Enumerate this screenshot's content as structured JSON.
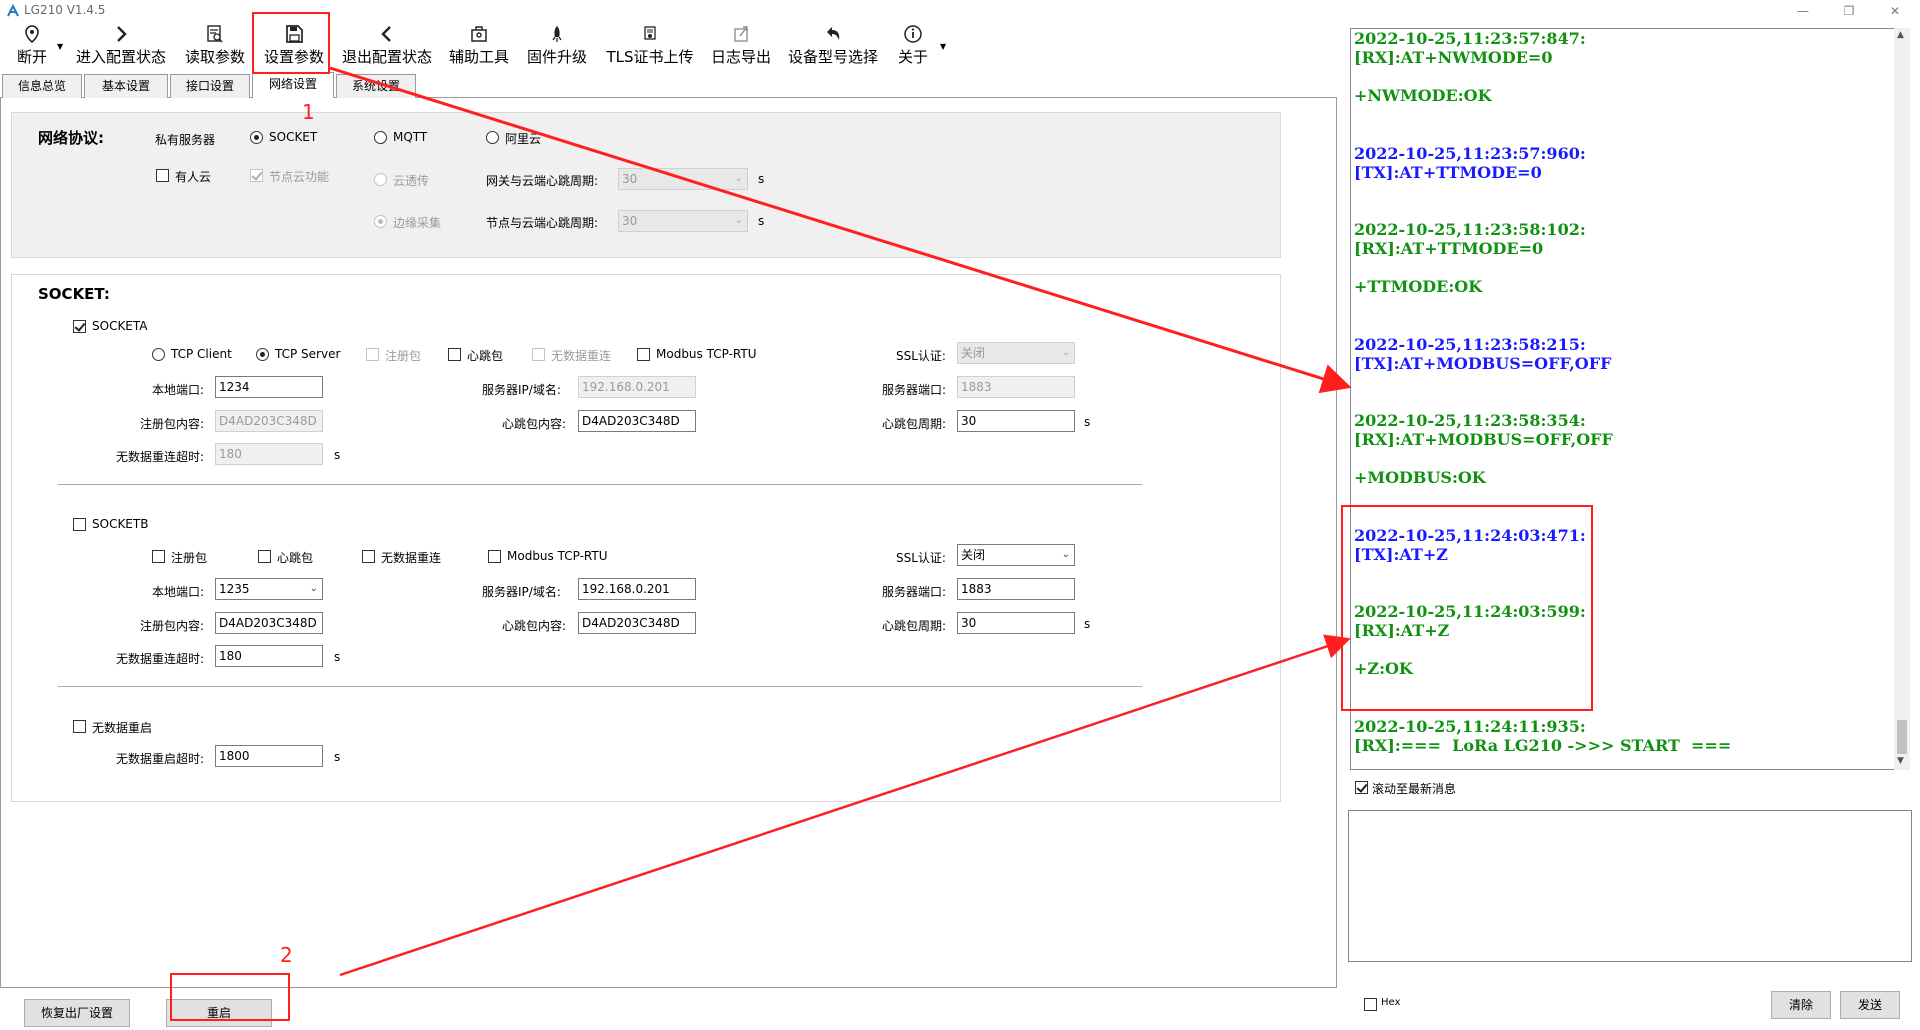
{
  "window": {
    "title": "LG210 V1.4.5"
  },
  "toolbar": {
    "items": [
      {
        "label": "断开",
        "icon": "location-pin-icon"
      },
      {
        "label": "进入配置状态",
        "icon": "chevron-right-icon"
      },
      {
        "label": "读取参数",
        "icon": "read-document-icon"
      },
      {
        "label": "设置参数",
        "icon": "save-icon"
      },
      {
        "label": "退出配置状态",
        "icon": "chevron-left-icon"
      },
      {
        "label": "辅助工具",
        "icon": "toolbox-icon"
      },
      {
        "label": "固件升级",
        "icon": "rocket-icon"
      },
      {
        "label": "TLS证书上传",
        "icon": "certificate-icon"
      },
      {
        "label": "日志导出",
        "icon": "export-icon"
      },
      {
        "label": "设备型号选择",
        "icon": "undo-arrow-icon"
      },
      {
        "label": "关于",
        "icon": "info-icon"
      }
    ]
  },
  "tabs": [
    "信息总览",
    "基本设置",
    "接口设置",
    "网络设置",
    "系统设置"
  ],
  "active_tab": "网络设置",
  "protocol": {
    "heading": "网络协议:",
    "private_server": "私有服务器",
    "socket": "SOCKET",
    "mqtt": "MQTT",
    "aliyun": "阿里云",
    "youren_cloud": "有人云",
    "node_cloud": "节点云功能",
    "cloud_passthrough": "云透传",
    "edge_collect": "边缘采集",
    "gateway_heartbeat_label": "网关与云端心跳周期:",
    "gateway_heartbeat_value": "30",
    "node_heartbeat_label": "节点与云端心跳周期:",
    "node_heartbeat_value": "30",
    "unit_s": "s"
  },
  "socket": {
    "heading": "SOCKET:",
    "a": {
      "enable_label": "SOCKETA",
      "tcp_client": "TCP Client",
      "tcp_server": "TCP Server",
      "register_pkt": "注册包",
      "heartbeat_pkt": "心跳包",
      "nodata_reconnect": "无数据重连",
      "modbus": "Modbus TCP-RTU",
      "ssl_label": "SSL认证:",
      "ssl_value": "关闭",
      "local_port_label": "本地端口:",
      "local_port": "1234",
      "server_ip_label": "服务器IP/域名:",
      "server_ip": "192.168.0.201",
      "server_port_label": "服务器端口:",
      "server_port": "1883",
      "register_content_label": "注册包内容:",
      "register_content": "D4AD203C348D",
      "heartbeat_content_label": "心跳包内容:",
      "heartbeat_content": "D4AD203C348D",
      "heartbeat_period_label": "心跳包周期:",
      "heartbeat_period": "30",
      "nodata_timeout_label": "无数据重连超时:",
      "nodata_timeout": "180",
      "unit_s": "s"
    },
    "b": {
      "enable_label": "SOCKETB",
      "register_pkt": "注册包",
      "heartbeat_pkt": "心跳包",
      "nodata_reconnect": "无数据重连",
      "modbus": "Modbus TCP-RTU",
      "ssl_label": "SSL认证:",
      "ssl_value": "关闭",
      "local_port_label": "本地端口:",
      "local_port": "1235",
      "server_ip_label": "服务器IP/域名:",
      "server_ip": "192.168.0.201",
      "server_port_label": "服务器端口:",
      "server_port": "1883",
      "register_content_label": "注册包内容:",
      "register_content": "D4AD203C348D",
      "heartbeat_content_label": "心跳包内容:",
      "heartbeat_content": "D4AD203C348D",
      "heartbeat_period_label": "心跳包周期:",
      "heartbeat_period": "30",
      "nodata_timeout_label": "无数据重连超时:",
      "nodata_timeout": "180",
      "unit_s": "s"
    },
    "restart": {
      "enable_label": "无数据重启",
      "timeout_label": "无数据重启超时:",
      "timeout": "1800",
      "unit_s": "s"
    }
  },
  "bottom": {
    "factory_reset": "恢复出厂设置",
    "restart": "重启"
  },
  "log": {
    "entries": [
      {
        "time": "2022-10-25,11:23:57:847:",
        "line": "[RX]:AT+NWMODE=0",
        "reply": "+NWMODE:OK",
        "dir": "rx"
      },
      {
        "time": "2022-10-25,11:23:57:960:",
        "line": "[TX]:AT+TTMODE=0",
        "reply": "",
        "dir": "tx"
      },
      {
        "time": "2022-10-25,11:23:58:102:",
        "line": "[RX]:AT+TTMODE=0",
        "reply": "+TTMODE:OK",
        "dir": "rx"
      },
      {
        "time": "2022-10-25,11:23:58:215:",
        "line": "[TX]:AT+MODBUS=OFF,OFF",
        "reply": "",
        "dir": "tx"
      },
      {
        "time": "2022-10-25,11:23:58:354:",
        "line": "[RX]:AT+MODBUS=OFF,OFF",
        "reply": "+MODBUS:OK",
        "dir": "rx"
      },
      {
        "time": "2022-10-25,11:24:03:471:",
        "line": "[TX]:AT+Z",
        "reply": "",
        "dir": "tx"
      },
      {
        "time": "2022-10-25,11:24:03:599:",
        "line": "[RX]:AT+Z",
        "reply": "+Z:OK",
        "dir": "rx"
      },
      {
        "time": "2022-10-25,11:24:11:935:",
        "line": "[RX]:===  LoRa LG210 ->>> START  ===",
        "reply": "",
        "dir": "rx"
      }
    ],
    "autoscroll_label": "滚动至最新消息",
    "hex_label": "Hex",
    "clear_label": "清除",
    "send_label": "发送"
  },
  "annotations": {
    "marker_1": "1",
    "marker_2": "2",
    "color": "#ff1f1f"
  },
  "colors": {
    "tx": "#1a1aff",
    "rx": "#119111"
  }
}
